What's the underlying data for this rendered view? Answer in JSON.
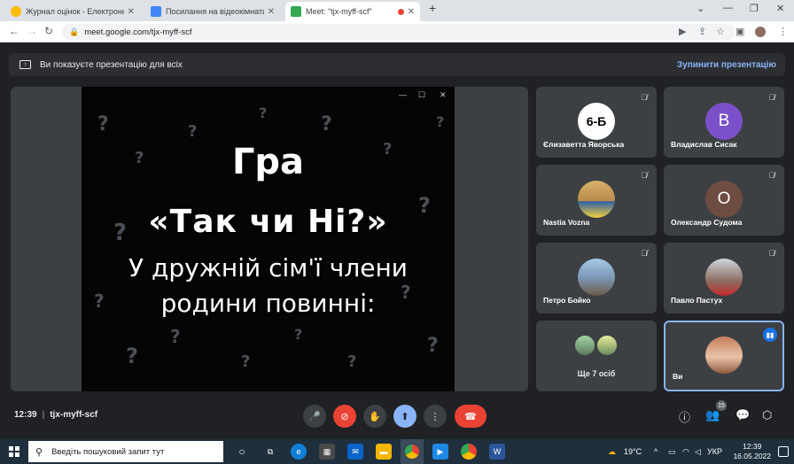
{
  "browser": {
    "tabs": [
      {
        "label": "Журнал оцінок - Електронні щ",
        "fav_color": "#fbbc04"
      },
      {
        "label": "Посилання на відеокімнати - Go",
        "fav_color": "#4285f4"
      },
      {
        "label": "Meet: \"tjx-myff-scf\"",
        "fav_color": "#34a853"
      }
    ],
    "new_tab": "+",
    "url": "meet.google.com/tjx-myff-scf"
  },
  "banner": {
    "text": "Ви показуєте презентацію для всіх",
    "stop": "Зупинити презентацію"
  },
  "slide": {
    "line1": "Гра",
    "line2": "«Так чи Ні?»",
    "line3": "У дружній сім'ї члени",
    "line4": "родини повинні:"
  },
  "participants": [
    {
      "name": "Єлизаветта Яворська",
      "initial": "6-Б",
      "avatar_color": "#ffffff",
      "text_color": "#000000"
    },
    {
      "name": "Владислав Сисак",
      "initial": "В",
      "avatar_color": "#7b4fc9",
      "text_color": "#ffffff"
    },
    {
      "name": "Nastia Vozna",
      "initial": "",
      "avatar_color": "#c9a75a",
      "text_color": "#ffffff"
    },
    {
      "name": "Олександр Судома",
      "initial": "О",
      "avatar_color": "#6d4c41",
      "text_color": "#ffffff"
    },
    {
      "name": "Петро Бойко",
      "initial": "",
      "avatar_color": "#7fa6c9",
      "text_color": "#ffffff"
    },
    {
      "name": "Павло Пастух",
      "initial": "",
      "avatar_color": "#9e8e7e",
      "text_color": "#ffffff"
    }
  ],
  "more": {
    "label": "Ще 7 осіб"
  },
  "self": {
    "name": "Ви"
  },
  "bottom": {
    "time": "12:39",
    "code": "tjx-myff-scf",
    "people_count": "15"
  },
  "taskbar": {
    "search_placeholder": "Введіть пошуковий запит тут",
    "weather": "19°C",
    "lang": "УКР",
    "time": "12:39",
    "date": "16.05.2022"
  },
  "colors": {
    "meet_bg": "#202124",
    "tile_bg": "#3c4043",
    "accent": "#8ab4f8",
    "end_call": "#ea4335"
  }
}
